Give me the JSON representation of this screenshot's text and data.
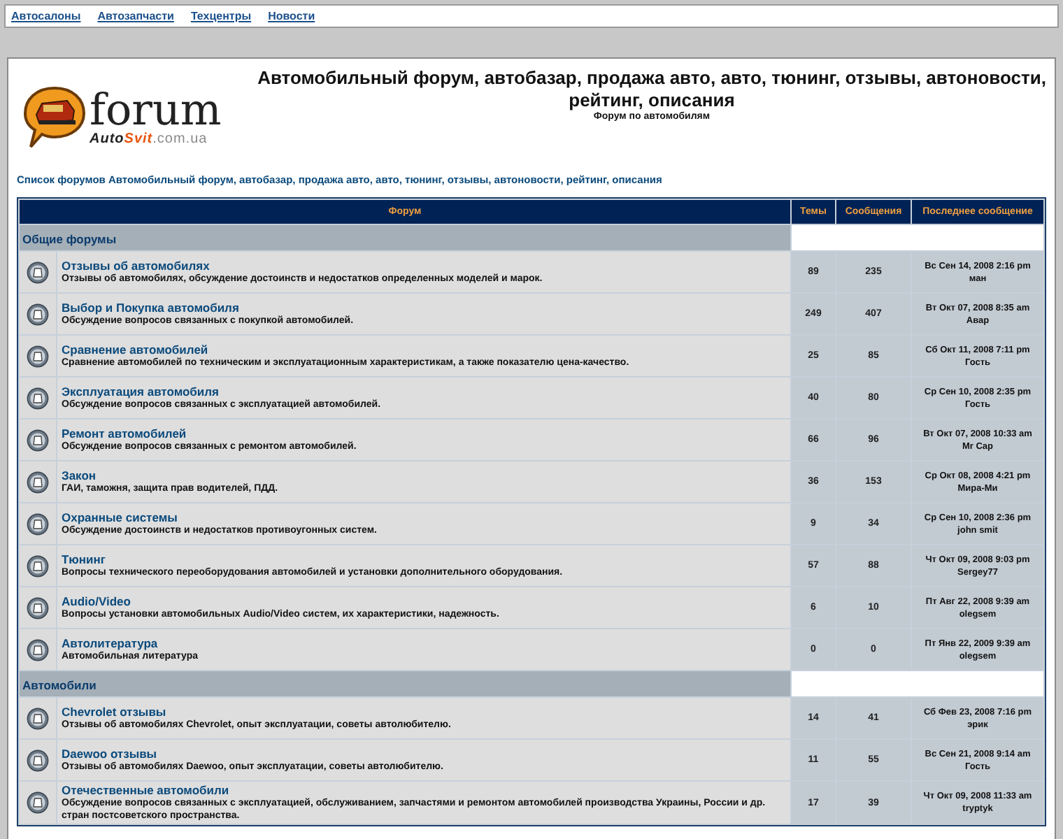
{
  "top_links": [
    "Автосалоны",
    "Автозапчасти",
    "Техцентры",
    "Новости"
  ],
  "logo": {
    "word": "forum",
    "brand_dark": "Auto",
    "brand_accent": "Svit",
    "domain": ".com.ua"
  },
  "site_title": "Автомобильный форум, автобазар, продажа авто, авто, тюнинг, отзывы, автоновости, рейтинг, описания",
  "site_subtitle": "Форум по автомобилям",
  "breadcrumb": "Список форумов Автомобильный форум, автобазар, продажа авто, авто, тюнинг, отзывы, автоновости, рейтинг, описания",
  "table": {
    "columns": [
      "Форум",
      "Темы",
      "Сообщения",
      "Последнее сообщение"
    ],
    "categories": [
      {
        "name": "Общие форумы",
        "forums": [
          {
            "title": "Отзывы об автомобилях",
            "description": "Отзывы об автомобилях, обсуждение достоинств и недостатков определенных моделей и марок.",
            "topics": "89",
            "posts": "235",
            "last_date": "Вс Сен 14, 2008 2:16 pm",
            "last_author": "ман"
          },
          {
            "title": "Выбор и Покупка автомобиля",
            "description": "Обсуждение вопросов связанных с покупкой автомобилей.",
            "topics": "249",
            "posts": "407",
            "last_date": "Вт Окт 07, 2008 8:35 am",
            "last_author": "Авар"
          },
          {
            "title": "Сравнение автомобилей",
            "description": "Сравнение автомобилей по техническим и эксплуатационным характеристикам, а также показателю цена-качество.",
            "topics": "25",
            "posts": "85",
            "last_date": "Сб Окт 11, 2008 7:11 pm",
            "last_author": "Гость"
          },
          {
            "title": "Эксплуатация автомобиля",
            "description": "Обсуждение вопросов связанных с эксплуатацией автомобилей.",
            "topics": "40",
            "posts": "80",
            "last_date": "Ср Сен 10, 2008 2:35 pm",
            "last_author": "Гость"
          },
          {
            "title": "Ремонт автомобилей",
            "description": "Обсуждение вопросов связанных с ремонтом автомобилей.",
            "topics": "66",
            "posts": "96",
            "last_date": "Вт Окт 07, 2008 10:33 am",
            "last_author": "Mr Cap"
          },
          {
            "title": "Закон",
            "description": "ГАИ, таможня, защита прав водителей, ПДД.",
            "topics": "36",
            "posts": "153",
            "last_date": "Ср Окт 08, 2008 4:21 pm",
            "last_author": "Мира-Ми"
          },
          {
            "title": "Охранные системы",
            "description": "Обсуждение достоинств и недостатков противоугонных систем.",
            "topics": "9",
            "posts": "34",
            "last_date": "Ср Сен 10, 2008 2:36 pm",
            "last_author": "john smit"
          },
          {
            "title": "Тюнинг",
            "description": "Вопросы технического переоборудования автомобилей и установки дополнительного оборудования.",
            "topics": "57",
            "posts": "88",
            "last_date": "Чт Окт 09, 2008 9:03 pm",
            "last_author": "Sergey77"
          },
          {
            "title": "Audio/Video",
            "description": "Вопросы установки автомобильных Audio/Video систем, их характеристики, надежность.",
            "topics": "6",
            "posts": "10",
            "last_date": "Пт Авг 22, 2008 9:39 am",
            "last_author": "olegsem"
          },
          {
            "title": "Автолитература",
            "description": "Автомобильная литература",
            "topics": "0",
            "posts": "0",
            "last_date": "Пт Янв 22, 2009 9:39 am",
            "last_author": "olegsem"
          }
        ]
      },
      {
        "name": "Автомобили",
        "forums": [
          {
            "title": "Chevrolet отзывы",
            "description": "Отзывы об автомобилях Chevrolet, опыт эксплуатации, советы автолюбителю.",
            "topics": "14",
            "posts": "41",
            "last_date": "Сб Фев 23, 2008 7:16 pm",
            "last_author": "эрик"
          },
          {
            "title": "Daewoo отзывы",
            "description": "Отзывы об автомобилях Daewoo, опыт эксплуатации, советы автолюбителю.",
            "topics": "11",
            "posts": "55",
            "last_date": "Вс Сен 21, 2008 9:14 am",
            "last_author": "Гость"
          },
          {
            "title": "Отечественные автомобили",
            "description": "Обсуждение вопросов связанных с эксплуатацией, обслуживанием, запчастями и ремонтом автомобилей производства Украины, России и др. стран постсоветского пространства.",
            "topics": "17",
            "posts": "39",
            "last_date": "Чт Окт 09, 2008 11:33 am",
            "last_author": "tryptyk"
          }
        ]
      }
    ]
  }
}
